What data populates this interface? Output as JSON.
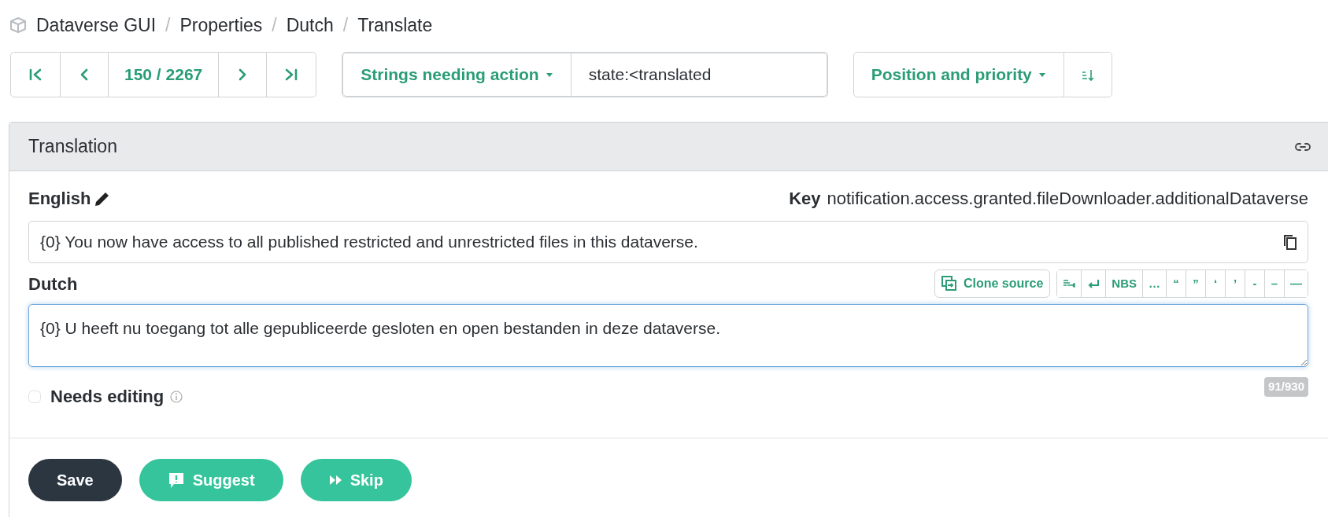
{
  "breadcrumb": [
    "Dataverse GUI",
    "Properties",
    "Dutch",
    "Translate"
  ],
  "breadcrumb_separator": "/",
  "navigation": {
    "position": "150 / 2267"
  },
  "filter": {
    "label": "Strings needing action",
    "query": "state:<translated"
  },
  "sort": {
    "label": "Position and priority"
  },
  "panel": {
    "title": "Translation"
  },
  "source": {
    "language": "English",
    "key_label": "Key",
    "key": "notification.access.granted.fileDownloader.additionalDataverse",
    "text": "{0} You now have access to all published restricted and unrestricted files in this dataverse."
  },
  "target": {
    "language": "Dutch",
    "clone_label": "Clone source",
    "special_chars": [
      {
        "kind": "tab"
      },
      {
        "kind": "return"
      },
      {
        "kind": "text",
        "label": "NBS"
      },
      {
        "kind": "text",
        "label": "…"
      },
      {
        "kind": "text",
        "label": "“"
      },
      {
        "kind": "text",
        "label": "”"
      },
      {
        "kind": "text",
        "label": "‘"
      },
      {
        "kind": "text",
        "label": "’"
      },
      {
        "kind": "text",
        "label": "-"
      },
      {
        "kind": "text",
        "label": "–"
      },
      {
        "kind": "text",
        "label": "—"
      }
    ],
    "text": "{0} U heeft nu toegang tot alle gepubliceerde gesloten en open bestanden in deze dataverse.",
    "needs_editing": {
      "label": "Needs editing",
      "checked": false
    },
    "counter": "91/930"
  },
  "actions": [
    {
      "kind": "save",
      "label": "Save"
    },
    {
      "kind": "suggest",
      "label": "Suggest"
    },
    {
      "kind": "skip",
      "label": "Skip"
    }
  ]
}
